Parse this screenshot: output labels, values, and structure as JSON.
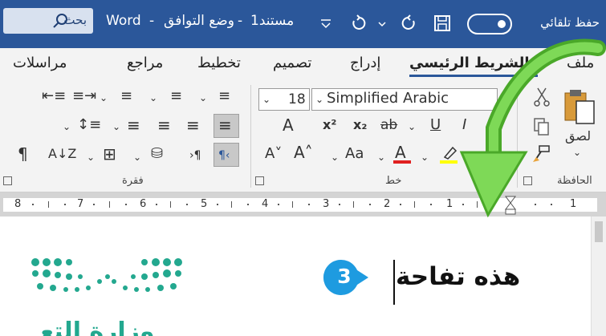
{
  "titlebar": {
    "autosave_label": "حفظ تلقائي",
    "doc_title": "مستند1",
    "compat_mode": "وضع التوافق",
    "app_name": "Word",
    "sep1": "-",
    "sep2": "-",
    "search_label": "بحث",
    "bg": "#2b579a"
  },
  "tabs": {
    "file": "ملف",
    "home": "الشريط الرئيسي",
    "insert": "إدراج",
    "design": "تصميم",
    "layout": "تخطيط",
    "references": "مراجع",
    "mailings": "مراسلات"
  },
  "ribbon": {
    "clipboard_label": "الحافظة",
    "paste_label": "لصق",
    "font_label": "خط",
    "paragraph_label": "فقرة",
    "font_size": "18",
    "font_name": "Simplified Arabic",
    "bold": "B",
    "italic": "I",
    "underline": "U",
    "subscript": "x₂",
    "superscript": "x²",
    "strike": "ab",
    "grow_font": "A˄",
    "shrink_font": "A˅",
    "change_case": "Aa",
    "font_color_letter": "A",
    "highlight_color": "#ffff00",
    "font_color": "#e02020",
    "sort_label": "A↓Z",
    "pilcrow": "¶"
  },
  "ruler": {
    "numbers": [
      "8",
      "7",
      "6",
      "5",
      "4",
      "3",
      "2",
      "1",
      "1"
    ]
  },
  "document": {
    "text": "هذه تفاحة",
    "step_number": "3",
    "step_color": "#1e9be0",
    "logo_text": "وزارة التعـ"
  },
  "icons": [
    "search-icon",
    "undo-icon",
    "redo-icon",
    "save-icon",
    "customize-icon",
    "cut-icon",
    "copy-icon",
    "format-painter-icon",
    "paste-icon"
  ]
}
